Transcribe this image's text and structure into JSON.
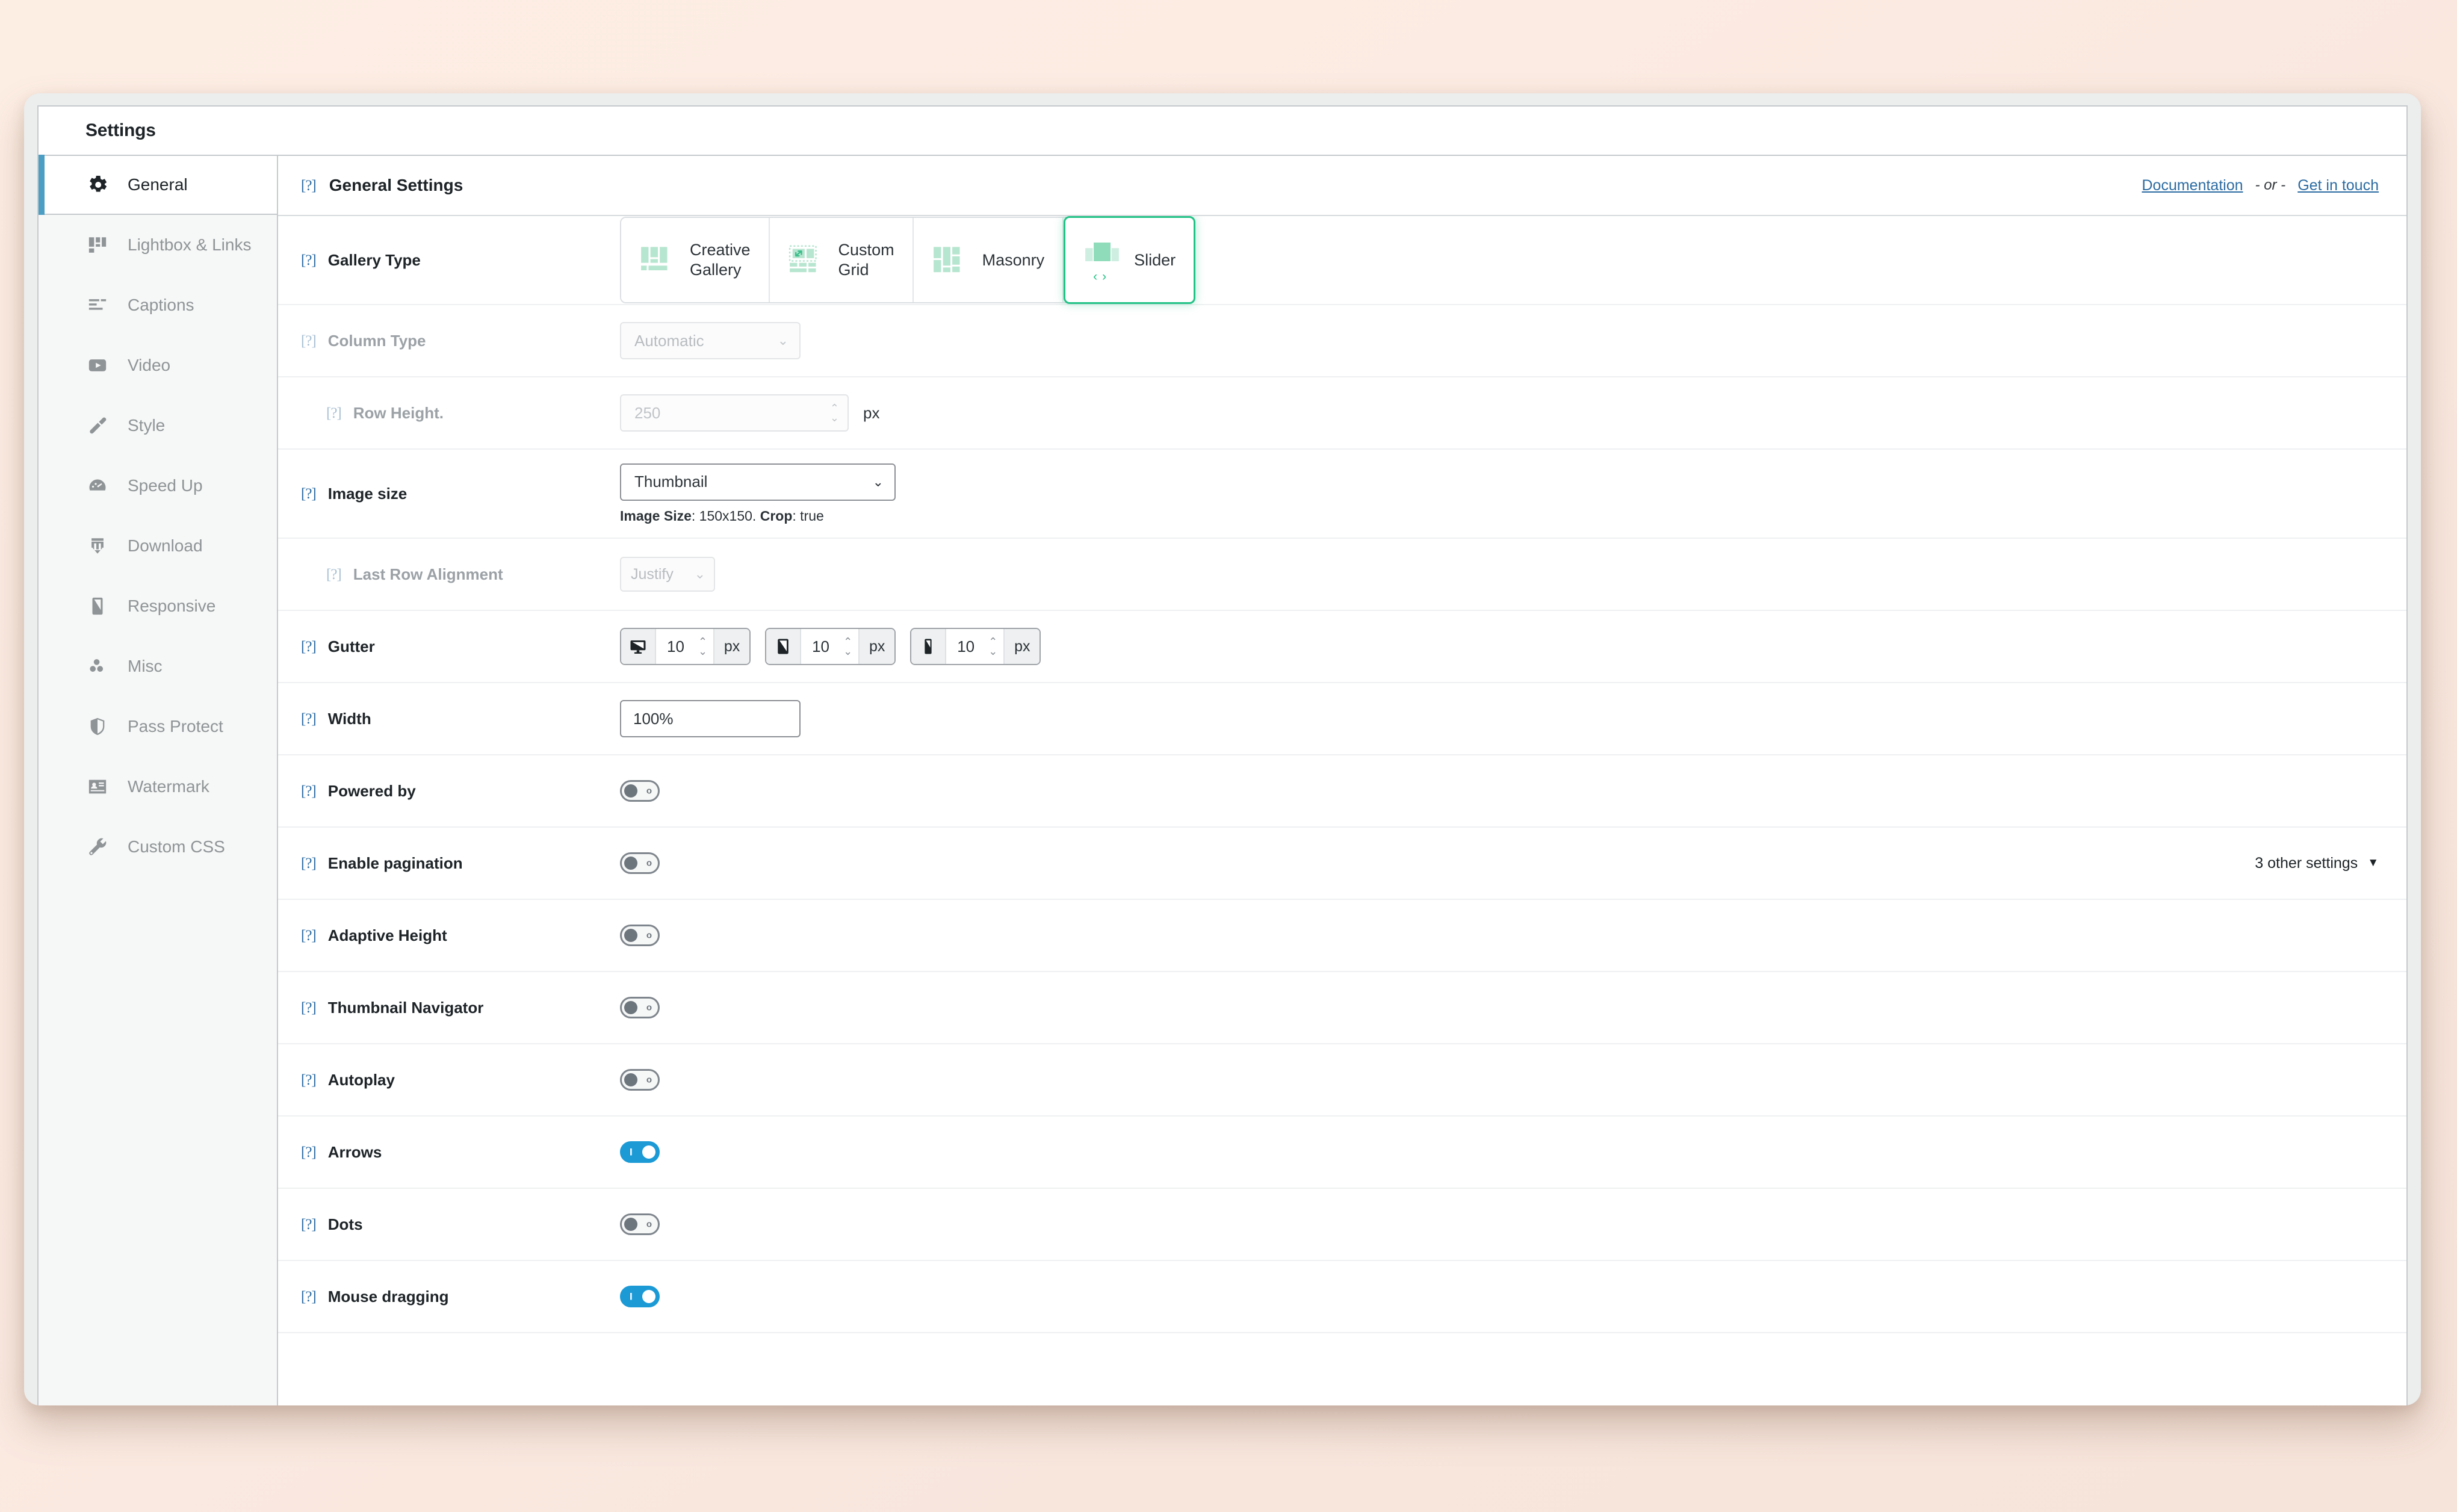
{
  "window": {
    "title": "Settings"
  },
  "sidebar": {
    "items": [
      {
        "label": "General",
        "icon": "gear-icon",
        "active": true
      },
      {
        "label": "Lightbox & Links",
        "icon": "lightbox-icon",
        "active": false
      },
      {
        "label": "Captions",
        "icon": "captions-icon",
        "active": false
      },
      {
        "label": "Video",
        "icon": "video-icon",
        "active": false
      },
      {
        "label": "Style",
        "icon": "brush-icon",
        "active": false
      },
      {
        "label": "Speed Up",
        "icon": "speedometer-icon",
        "active": false
      },
      {
        "label": "Download",
        "icon": "download-icon",
        "active": false
      },
      {
        "label": "Responsive",
        "icon": "mobile-icon",
        "active": false
      },
      {
        "label": "Misc",
        "icon": "dots-icon",
        "active": false
      },
      {
        "label": "Pass Protect",
        "icon": "shield-icon",
        "active": false
      },
      {
        "label": "Watermark",
        "icon": "watermark-icon",
        "active": false
      },
      {
        "label": "Custom CSS",
        "icon": "wrench-icon",
        "active": false
      }
    ]
  },
  "header": {
    "help_mark": "[?]",
    "title": "General Settings",
    "documentation_link": "Documentation",
    "separator": "- or -",
    "contact_link": "Get in touch"
  },
  "rows": {
    "gallery_type": {
      "help_mark": "[?]",
      "label": "Gallery Type",
      "options": [
        {
          "label": "Creative\nGallery",
          "icon": "creative-gallery-icon",
          "selected": false
        },
        {
          "label": "Custom\nGrid",
          "icon": "custom-grid-icon",
          "selected": false
        },
        {
          "label": "Masonry",
          "icon": "masonry-icon",
          "selected": false
        },
        {
          "label": "Slider",
          "icon": "slider-icon",
          "selected": true
        }
      ]
    },
    "column_type": {
      "help_mark": "[?]",
      "label": "Column Type",
      "value": "Automatic",
      "disabled": true
    },
    "row_height": {
      "help_mark": "[?]",
      "label": "Row Height.",
      "value": "250",
      "unit": "px",
      "disabled": true
    },
    "image_size": {
      "help_mark": "[?]",
      "label": "Image size",
      "value": "Thumbnail",
      "note_label_size": "Image Size",
      "note_value_size": ": 150x150. ",
      "note_label_crop": "Crop",
      "note_value_crop": ": true"
    },
    "last_row_alignment": {
      "help_mark": "[?]",
      "label": "Last Row Alignment",
      "value": "Justify",
      "disabled": true
    },
    "gutter": {
      "help_mark": "[?]",
      "label": "Gutter",
      "fields": [
        {
          "device": "desktop-icon",
          "value": "10",
          "unit": "px"
        },
        {
          "device": "tablet-icon",
          "value": "10",
          "unit": "px"
        },
        {
          "device": "mobile-icon",
          "value": "10",
          "unit": "px"
        }
      ]
    },
    "width": {
      "help_mark": "[?]",
      "label": "Width",
      "value": "100%"
    },
    "powered_by": {
      "help_mark": "[?]",
      "label": "Powered by",
      "state": "off"
    },
    "enable_pagination": {
      "help_mark": "[?]",
      "label": "Enable pagination",
      "state": "off"
    },
    "adaptive_height": {
      "help_mark": "[?]",
      "label": "Adaptive Height",
      "state": "off"
    },
    "thumbnail_navigator": {
      "help_mark": "[?]",
      "label": "Thumbnail Navigator",
      "state": "off"
    },
    "autoplay": {
      "help_mark": "[?]",
      "label": "Autoplay",
      "state": "off"
    },
    "arrows": {
      "help_mark": "[?]",
      "label": "Arrows",
      "state": "on"
    },
    "dots": {
      "help_mark": "[?]",
      "label": "Dots",
      "state": "off"
    },
    "mouse_dragging": {
      "help_mark": "[?]",
      "label": "Mouse dragging",
      "state": "on"
    }
  },
  "other_settings": {
    "label": "3 other settings",
    "caret": "▼"
  },
  "toggle_marks": {
    "off": "o",
    "on": "I"
  },
  "colors": {
    "accent_selected": "#22c286",
    "toggle_on": "#1c9ad6",
    "link": "#2d6ca2",
    "active_bar": "#4d9ec4",
    "icon_tint": "#b7e6d0"
  }
}
